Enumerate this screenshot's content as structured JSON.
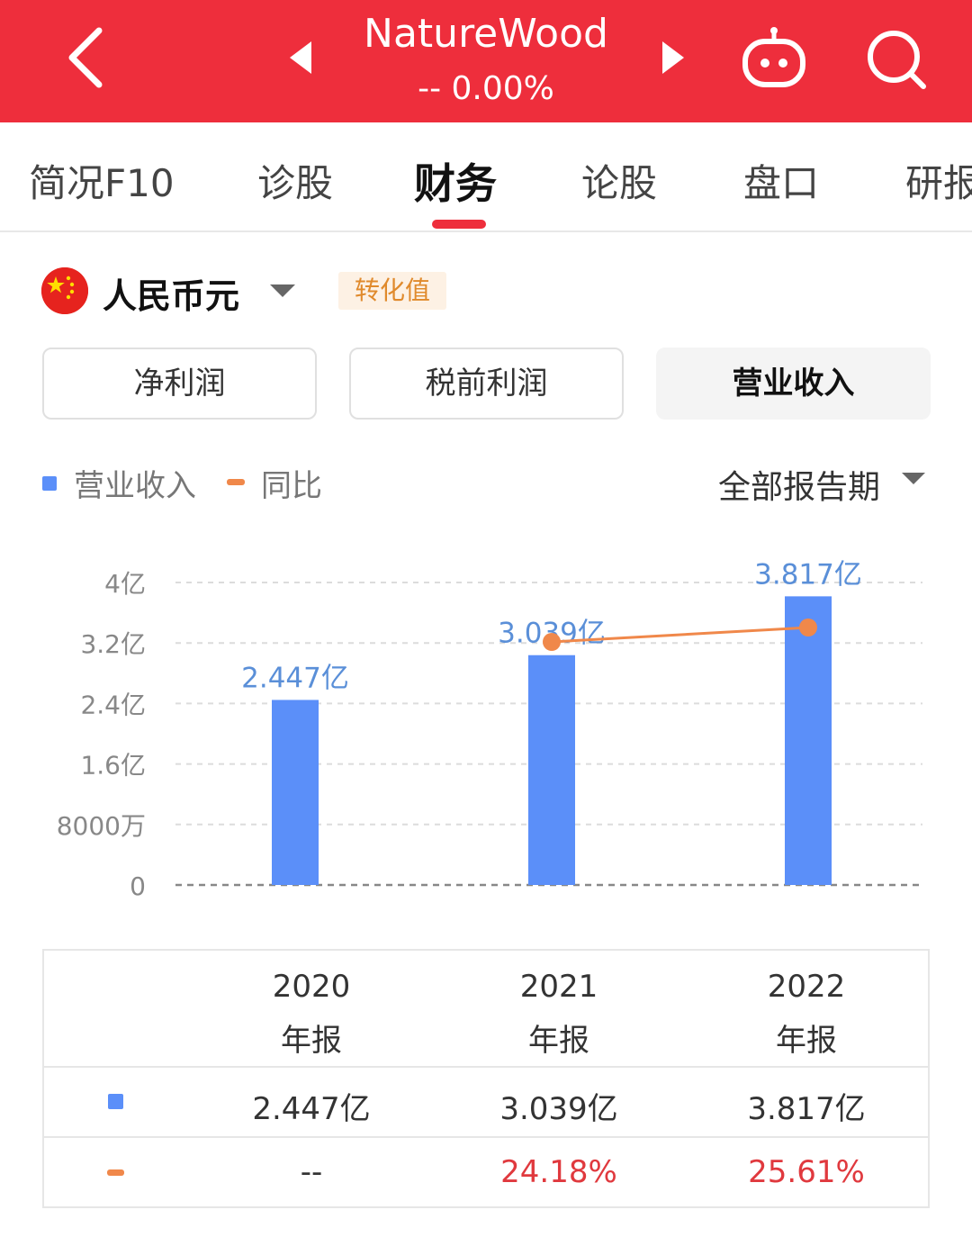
{
  "header": {
    "title": "NatureWood",
    "subtitle": "-- 0.00%",
    "bg_color": "#ee2e3c",
    "icons": [
      "chevron-left-icon",
      "triangle-left-icon",
      "triangle-right-icon",
      "robot-icon",
      "search-icon"
    ]
  },
  "tabs": [
    {
      "label": "简况F10"
    },
    {
      "label": "诊股"
    },
    {
      "label": "财务",
      "active": true
    },
    {
      "label": "论股"
    },
    {
      "label": "盘口"
    },
    {
      "label": "研报"
    }
  ],
  "currency": {
    "flag_icon": "china-flag-icon",
    "label": "人民币元",
    "badge": "转化值"
  },
  "metrics": [
    {
      "label": "净利润"
    },
    {
      "label": "税前利润"
    },
    {
      "label": "营业收入",
      "active": true
    }
  ],
  "legend": {
    "revenue": "营业收入",
    "yoy": "同比",
    "period": "全部报告期"
  },
  "chart_data": {
    "type": "bar",
    "categories": [
      "2020",
      "2021",
      "2022"
    ],
    "series": [
      {
        "name": "营业收入",
        "type": "bar",
        "values": [
          2.447,
          3.039,
          3.817
        ],
        "labels": [
          "2.447亿",
          "3.039亿",
          "3.817亿"
        ],
        "color": "#5b8ff9"
      },
      {
        "name": "同比",
        "type": "line",
        "values": [
          null,
          24.18,
          25.61
        ],
        "color": "#f0884a"
      }
    ],
    "ylim": [
      0,
      4
    ],
    "yticks": [
      0,
      0.8,
      1.6,
      2.4,
      3.2,
      4
    ],
    "ytick_labels": [
      "0",
      "8000万",
      "1.6亿",
      "2.4亿",
      "3.2亿",
      "4亿"
    ],
    "grid": true,
    "unit": "亿"
  },
  "table": {
    "columns": [
      {
        "year": "2020",
        "type": "年报"
      },
      {
        "year": "2021",
        "type": "年报"
      },
      {
        "year": "2022",
        "type": "年报"
      }
    ],
    "revenue": [
      "2.447亿",
      "3.039亿",
      "3.817亿"
    ],
    "yoy": [
      "--",
      "24.18%",
      "25.61%"
    ],
    "yoy_color": "#e0393e"
  }
}
